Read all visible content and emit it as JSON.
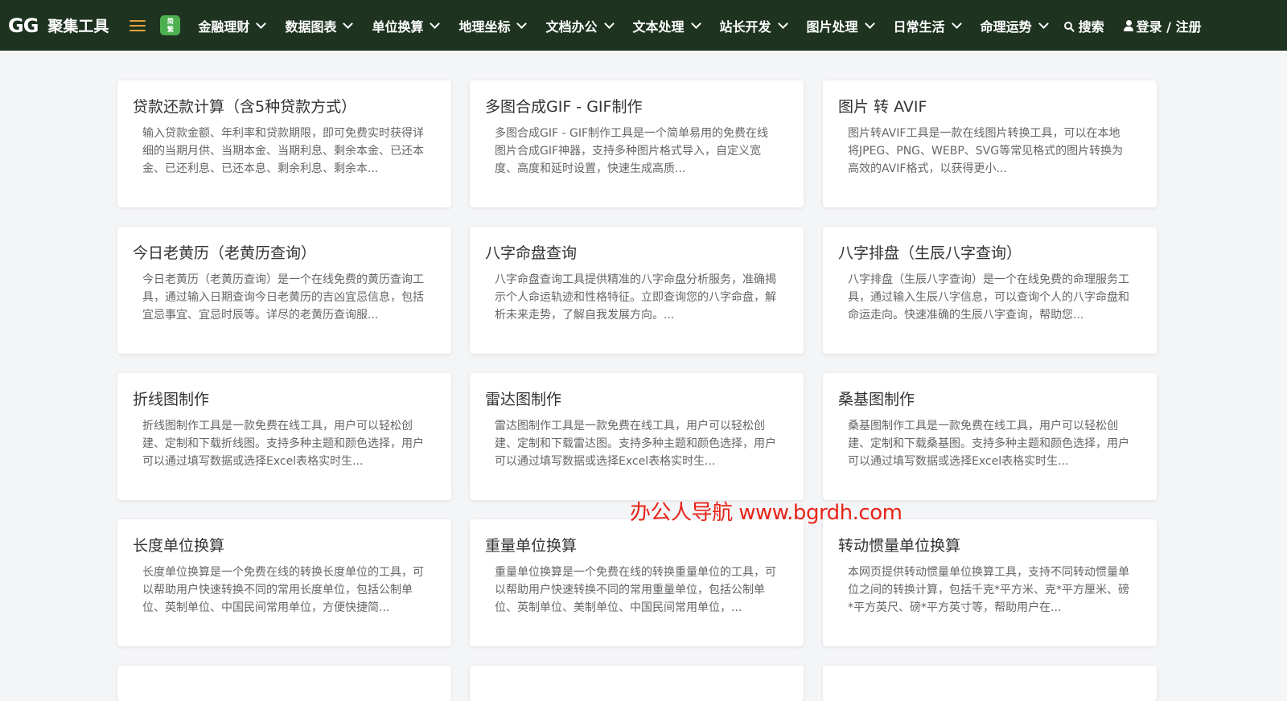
{
  "header": {
    "logo_mark": "GG",
    "logo_text": "聚集工具",
    "trad_icon_top": "简",
    "trad_icon_bottom": "繁",
    "nav": [
      {
        "label": "金融理财"
      },
      {
        "label": "数据图表"
      },
      {
        "label": "单位换算"
      },
      {
        "label": "地理坐标"
      },
      {
        "label": "文档办公"
      },
      {
        "label": "文本处理"
      },
      {
        "label": "站长开发"
      },
      {
        "label": "图片处理"
      },
      {
        "label": "日常生活"
      },
      {
        "label": "命理运势"
      }
    ],
    "search_label": "搜索",
    "login_label": "登录 / 注册"
  },
  "cards": [
    {
      "title": "贷款还款计算（含5种贷款方式）",
      "desc": "输入贷款金额、年利率和贷款期限，即可免费实时获得详细的当期月供、当期本金、当期利息、剩余本金、已还本金、已还利息、已还本息、剩余利息、剩余本..."
    },
    {
      "title": "多图合成GIF - GIF制作",
      "desc": "多图合成GIF - GIF制作工具是一个简单易用的免费在线图片合成GIF神器，支持多种图片格式导入，自定义宽度、高度和延时设置，快速生成高质..."
    },
    {
      "title": "图片 转 AVIF",
      "desc": "图片转AVIF工具是一款在线图片转换工具，可以在本地将JPEG、PNG、WEBP、SVG等常见格式的图片转换为高效的AVIF格式，以获得更小..."
    },
    {
      "title": "今日老黄历（老黄历查询）",
      "desc": "今日老黄历（老黄历查询）是一个在线免费的黄历查询工具，通过输入日期查询今日老黄历的吉凶宜忌信息，包括宜忌事宜、宜忌时辰等。详尽的老黄历查询服..."
    },
    {
      "title": "八字命盘查询",
      "desc": "八字命盘查询工具提供精准的八字命盘分析服务，准确揭示个人命运轨迹和性格特征。立即查询您的八字命盘，解析未来走势，了解自我发展方向。..."
    },
    {
      "title": "八字排盘（生辰八字查询）",
      "desc": "八字排盘（生辰八字查询）是一个在线免费的命理服务工具，通过输入生辰八字信息，可以查询个人的八字命盘和命运走向。快速准确的生辰八字查询，帮助您..."
    },
    {
      "title": "折线图制作",
      "desc": "折线图制作工具是一款免费在线工具，用户可以轻松创建、定制和下载折线图。支持多种主题和颜色选择，用户可以通过填写数据或选择Excel表格实时生..."
    },
    {
      "title": "雷达图制作",
      "desc": "雷达图制作工具是一款免费在线工具，用户可以轻松创建、定制和下载雷达图。支持多种主题和颜色选择，用户可以通过填写数据或选择Excel表格实时生..."
    },
    {
      "title": "桑基图制作",
      "desc": "桑基图制作工具是一款免费在线工具，用户可以轻松创建、定制和下载桑基图。支持多种主题和颜色选择，用户可以通过填写数据或选择Excel表格实时生..."
    },
    {
      "title": "长度单位换算",
      "desc": "长度单位换算是一个免费在线的转换长度单位的工具，可以帮助用户快速转换不同的常用长度单位，包括公制单位、英制单位、中国民间常用单位，方便快捷简..."
    },
    {
      "title": "重量单位换算",
      "desc": "重量单位换算是一个免费在线的转换重量单位的工具，可以帮助用户快速转换不同的常用重量单位，包括公制单位、英制单位、美制单位、中国民间常用单位，..."
    },
    {
      "title": "转动惯量单位换算",
      "desc": "本网页提供转动惯量单位换算工具，支持不同转动惯量单位之间的转换计算，包括千克*平方米、克*平方厘米、磅*平方英尺、磅*平方英寸等，帮助用户在..."
    }
  ],
  "watermark": "办公人导航 www.bgrdh.com"
}
